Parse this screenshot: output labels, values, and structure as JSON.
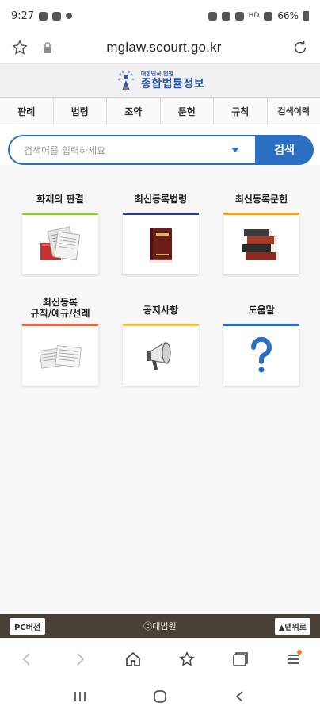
{
  "status_bar": {
    "time": "9:27",
    "battery": "66%",
    "network": "HD"
  },
  "browser": {
    "url": "mglaw.scourt.go.kr"
  },
  "site": {
    "logo_small": "대한민국 법원",
    "logo_main": "종합법률정보",
    "accent_color": "#2a6fc2"
  },
  "nav_tabs": [
    {
      "label": "판례"
    },
    {
      "label": "법령"
    },
    {
      "label": "조약"
    },
    {
      "label": "문헌"
    },
    {
      "label": "규칙"
    },
    {
      "label": "검색이력"
    }
  ],
  "search": {
    "placeholder": "검색어를 입력하세요",
    "button_label": "검색"
  },
  "menu": [
    {
      "label": "화제의 판결",
      "icon": "documents-book-icon"
    },
    {
      "label": "최신등록법령",
      "icon": "law-book-icon"
    },
    {
      "label": "최신등록문헌",
      "icon": "stacked-books-icon"
    },
    {
      "label_line1": "최신등록",
      "label_line2": "규칙/예규/선례",
      "icon": "papers-icon"
    },
    {
      "label": "공지사항",
      "icon": "megaphone-icon"
    },
    {
      "label": "도움말",
      "icon": "question-icon"
    }
  ],
  "footer": {
    "pc_version": "PC버전",
    "copyright": "ⓒ대법원",
    "to_top": "▲맨위로"
  }
}
